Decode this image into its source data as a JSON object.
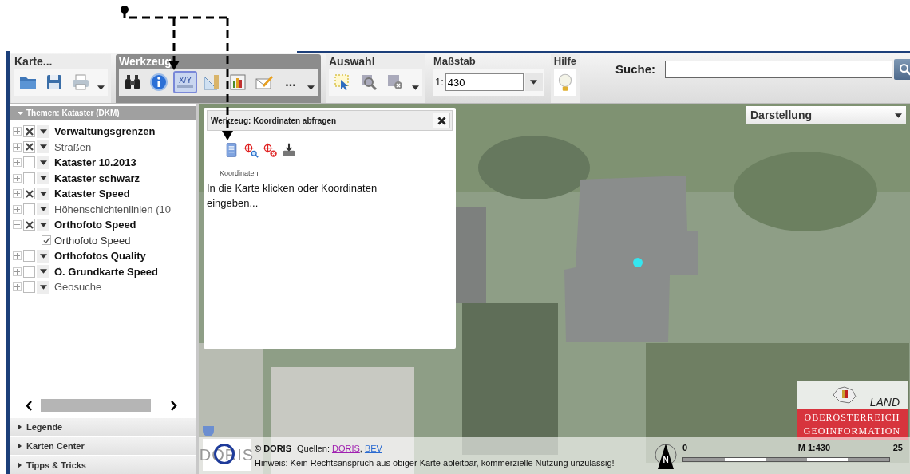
{
  "toolbar": {
    "groups": [
      {
        "title": "Karte...",
        "active": false,
        "tools": [
          {
            "kind": "folder",
            "selected": false
          },
          {
            "kind": "save",
            "selected": false
          },
          {
            "kind": "print",
            "selected": false
          }
        ],
        "dropdown": true
      },
      {
        "title": "Werkzeug",
        "active": true,
        "tools": [
          {
            "kind": "binoculars",
            "selected": false
          },
          {
            "kind": "info",
            "selected": false
          },
          {
            "kind": "xy",
            "label": "X/Y",
            "selected": true
          },
          {
            "kind": "ruler",
            "selected": false
          },
          {
            "kind": "chart",
            "selected": false
          },
          {
            "kind": "mail",
            "selected": false
          },
          {
            "kind": "more",
            "label": "...",
            "selected": false
          }
        ],
        "dropdown": true
      },
      {
        "title": "Auswahl",
        "active": false,
        "tools": [
          {
            "kind": "select",
            "selected": false
          },
          {
            "kind": "zoom-select",
            "selected": false
          },
          {
            "kind": "clear-select",
            "selected": false
          }
        ],
        "dropdown": true
      }
    ],
    "scale": {
      "title": "Maßstab",
      "prefix": "1:",
      "value": "430"
    },
    "help": {
      "title": "Hilfe"
    },
    "search": {
      "label": "Suche:"
    }
  },
  "sidebar": {
    "header": "Themen: Kataster (DKM)",
    "layers": [
      {
        "label": "Verwaltungsgrenzen",
        "bold": true,
        "checked": true,
        "expanded": false
      },
      {
        "label": "Straßen",
        "bold": false,
        "checked": true,
        "expanded": false
      },
      {
        "label": "Kataster 10.2013",
        "bold": true,
        "checked": false,
        "expanded": false
      },
      {
        "label": "Kataster schwarz",
        "bold": true,
        "checked": false,
        "expanded": false
      },
      {
        "label": "Kataster Speed",
        "bold": true,
        "checked": true,
        "expanded": false
      },
      {
        "label": "Höhenschichtenlinien (10",
        "bold": false,
        "checked": false,
        "expanded": false
      },
      {
        "label": "Orthofoto Speed",
        "bold": true,
        "checked": true,
        "expanded": true,
        "children": [
          {
            "label": "Orthofoto Speed",
            "checked": true
          }
        ]
      },
      {
        "label": "Orthofotos Quality",
        "bold": true,
        "checked": false,
        "expanded": false
      },
      {
        "label": "Ö. Grundkarte Speed",
        "bold": true,
        "checked": false,
        "expanded": false
      },
      {
        "label": "Geosuche",
        "bold": false,
        "checked": false,
        "expanded": false
      }
    ],
    "sections": [
      "Legende",
      "Karten Center",
      "Tipps & Tricks"
    ]
  },
  "popup": {
    "title": "Werkzeug: Koordinaten abfragen",
    "tools": [
      {
        "kind": "list"
      },
      {
        "kind": "target-zoom"
      },
      {
        "kind": "target-delete"
      },
      {
        "kind": "download"
      }
    ],
    "caption": "Koordinaten",
    "message": "In die Karte klicken oder Koordinaten eingeben..."
  },
  "map": {
    "display_dropdown": "Darstellung",
    "footer": {
      "logo": "DORIS",
      "copyright": "© DORIS",
      "sources_label": "Quellen:",
      "sources": [
        "DORIS",
        "BEV"
      ],
      "sources_separator": ",",
      "notice": "Hinweis: Kein Rechtsanspruch aus obiger Karte ableitbar, kommerzielle Nutzung unzulässig!"
    },
    "north": "N",
    "scalebar": {
      "start": "0",
      "scale": "M 1:430",
      "end": "25"
    },
    "land_logo": {
      "top": "LAND",
      "lines": [
        "OBERÖSTERREICH",
        "GEOINFORMATION"
      ]
    }
  }
}
